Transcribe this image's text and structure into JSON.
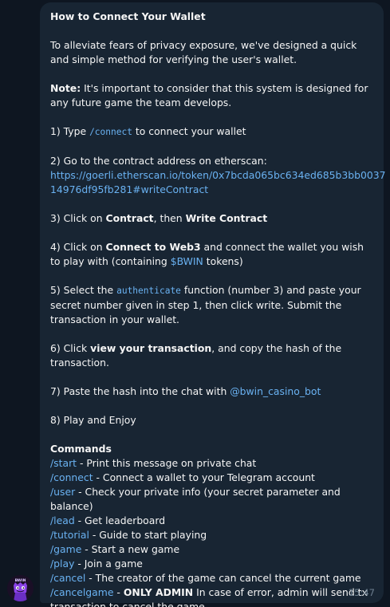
{
  "message": {
    "title": "How to Connect Your Wallet",
    "intro": "To alleviate fears of privacy exposure, we've designed a quick and simple method for verifying the user's wallet.",
    "note_label": "Note:",
    "note_text": " It's important to consider that this system is designed for any future game the team develops.",
    "step1_prefix": "1) Type ",
    "step1_code": "/connect",
    "step1_suffix": " to connect your wallet",
    "step2_text": "2) Go to the contract address on etherscan:",
    "step2_link_line1": "https://goerli.etherscan.io/token/0x7bcda065bc634ed685b3bb0037",
    "step2_link_line2": "14976df95fb281#writeContract",
    "step3_prefix": "3) Click on ",
    "step3_bold1": "Contract",
    "step3_mid": ", then ",
    "step3_bold2": "Write Contract",
    "step4_prefix": "4) Click on ",
    "step4_bold": "Connect to Web3",
    "step4_mid": " and connect the wallet you wish to play with (containing ",
    "step4_token": "$BWIN",
    "step4_suffix": " tokens)",
    "step5_prefix": "5) Select the ",
    "step5_code": "authenticate",
    "step5_suffix": " function (number 3) and paste your secret number given in step 1, then click write. Submit the transaction in your wallet.",
    "step6_prefix": "6) Click ",
    "step6_bold": "view your transaction",
    "step6_suffix": ", and copy the hash of the transaction.",
    "step7_prefix": "7) Paste the hash into the chat with ",
    "step7_mention": "@bwin_casino_bot",
    "step8_text": "8) Play and Enjoy",
    "commands_heading": "Commands",
    "commands": [
      {
        "cmd": "/start",
        "desc": " - Print this message on private chat"
      },
      {
        "cmd": "/connect",
        "desc": " - Connect a wallet to your Telegram account"
      },
      {
        "cmd": "/user",
        "desc": " - Check your private info (your secret parameter and balance)"
      },
      {
        "cmd": "/lead",
        "desc": " - Get leaderboard"
      },
      {
        "cmd": "/tutorial",
        "desc": " - Guide to start playing"
      },
      {
        "cmd": "/game",
        "desc": " - Start a new game"
      },
      {
        "cmd": "/play",
        "desc": " - Join a game"
      },
      {
        "cmd": "/cancel",
        "desc": " - The creator of the game can cancel the current game"
      }
    ],
    "cancelgame_cmd": "/cancelgame",
    "cancelgame_dash": " - ",
    "cancelgame_bold": "ONLY ADMIN",
    "cancelgame_text": " In case of error, admin will send tx transaction to cancel the game",
    "time": "15:47"
  },
  "avatar": {
    "label": "BWIN",
    "icon": "purple-mascot-icon"
  },
  "colors": {
    "background": "#0e1621",
    "bubble": "#182533",
    "link": "#6ab2f2",
    "text": "#f5f5f5",
    "time": "#6d7f8f"
  }
}
